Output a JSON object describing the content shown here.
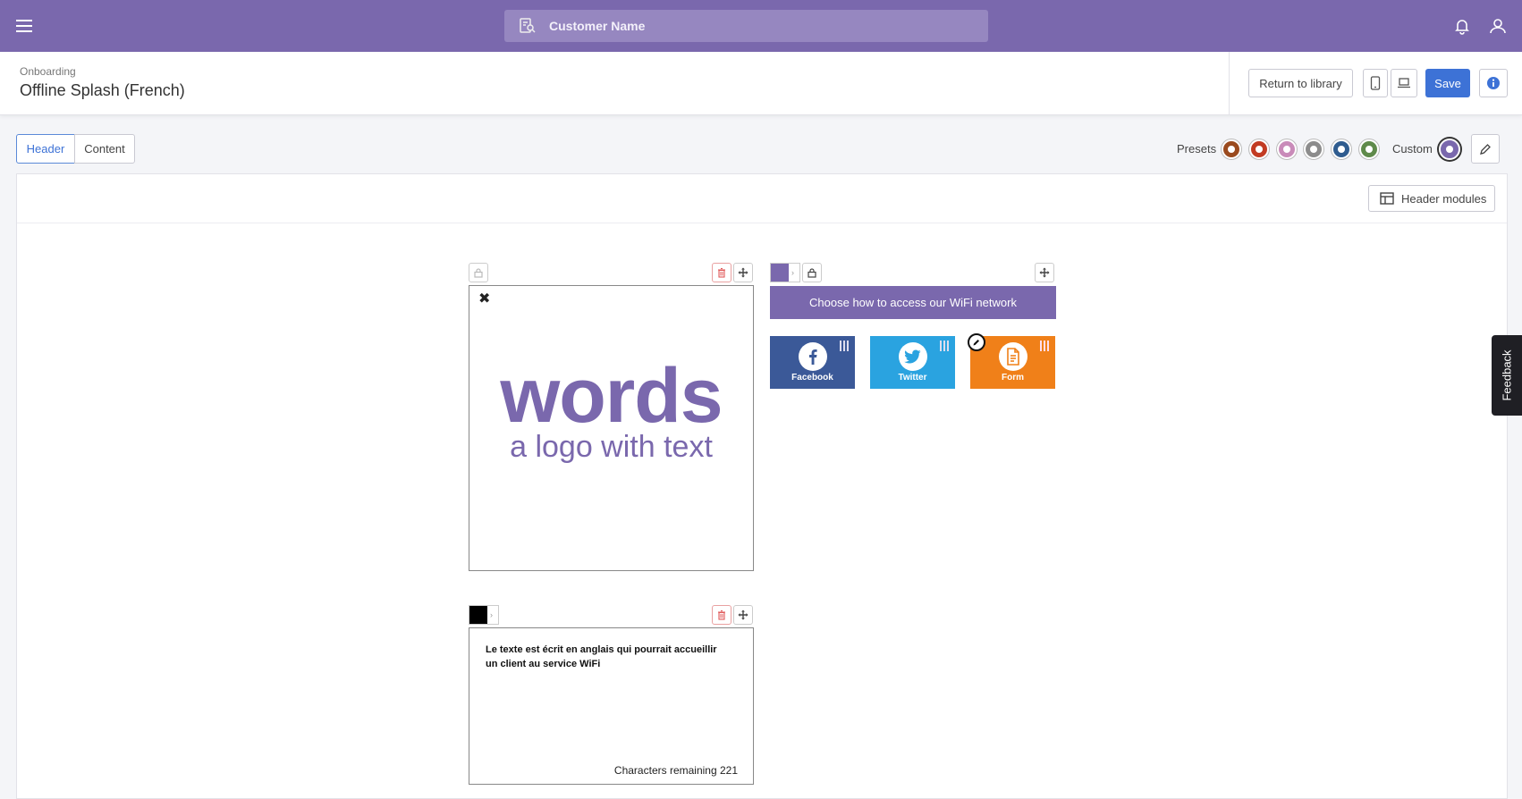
{
  "topbar": {
    "search_placeholder": "Customer Name"
  },
  "page": {
    "breadcrumb": "Onboarding",
    "title": "Offline Splash (French)"
  },
  "actions": {
    "return_label": "Return to library",
    "save_label": "Save"
  },
  "tabs": [
    {
      "label": "Header",
      "active": true
    },
    {
      "label": "Content",
      "active": false
    }
  ],
  "theme": {
    "presets_label": "Presets",
    "custom_label": "Custom",
    "preset_colors": [
      "#9a4a1e",
      "#c23b22",
      "#c98bb9",
      "#8c8c8c",
      "#2f5c8f",
      "#5f8a4a"
    ],
    "custom_color": "#7a68ad"
  },
  "panel": {
    "header_modules_label": "Header modules"
  },
  "logo_module": {
    "word": "words",
    "tagline": "a logo with text"
  },
  "wifi_module": {
    "bar_color": "#7a68ad",
    "heading": "Choose how to access our WiFi network",
    "options": [
      {
        "label": "Facebook",
        "color": "#3b5998",
        "icon": "facebook-icon"
      },
      {
        "label": "Twitter",
        "color": "#2aa3e0",
        "icon": "twitter-icon"
      },
      {
        "label": "Form",
        "color": "#f08019",
        "icon": "form-icon"
      }
    ]
  },
  "text_module": {
    "color": "#000000",
    "body": "Le texte est écrit en anglais qui pourrait accueillir un client au service WiFi",
    "counter": "Characters remaining 221"
  },
  "feedback_label": "Feedback"
}
